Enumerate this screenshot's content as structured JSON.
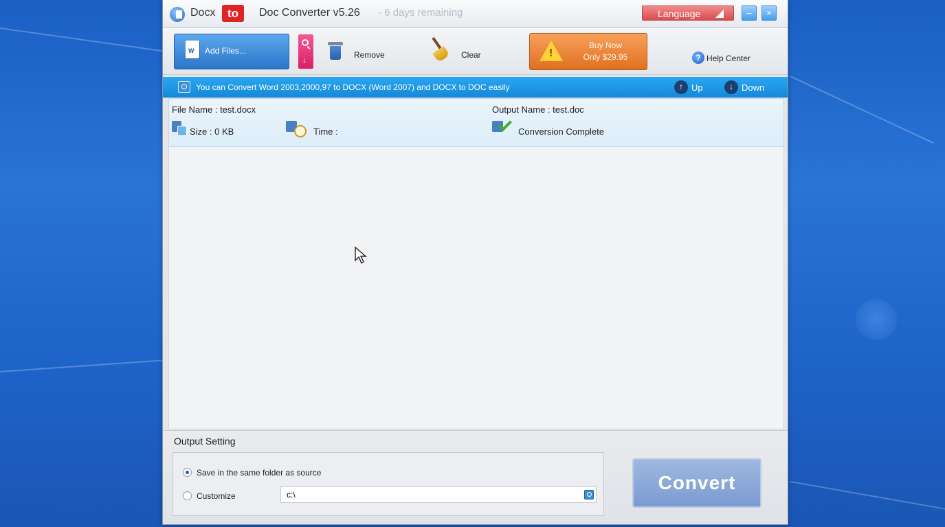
{
  "window": {
    "title_part1": "Docx",
    "title_to": "to",
    "title_part2": "Doc Converter v5.26",
    "trial_text": "- 6 days remaining",
    "language_label": "Language"
  },
  "toolbar": {
    "add_files_label": "Add Files...",
    "remove_label": "Remove",
    "clear_label": "Clear",
    "buy_line1": "Buy Now",
    "buy_line2": "Only $29.95",
    "help_label": "Help Center"
  },
  "infobar": {
    "message": "You can Convert Word 2003,2000,97 to DOCX (Word 2007) and DOCX to DOC easily",
    "up_label": "Up",
    "down_label": "Down"
  },
  "files": [
    {
      "file_name": "File Name : test.docx",
      "size": "Size : 0 KB",
      "time": "Time :",
      "output_name": "Output Name : test.doc",
      "status": "Conversion Complete"
    }
  ],
  "output": {
    "title": "Output Setting",
    "same_folder_label": "Save in the same folder as source",
    "customize_label": "Customize",
    "path_value": "c:\\",
    "selected": "same_folder"
  },
  "convert_label": "Convert",
  "colors": {
    "accent_blue": "#1488d8",
    "title_to_red": "#e02424",
    "buy_orange": "#e0701f",
    "add_files_blue": "#2a76c8"
  }
}
